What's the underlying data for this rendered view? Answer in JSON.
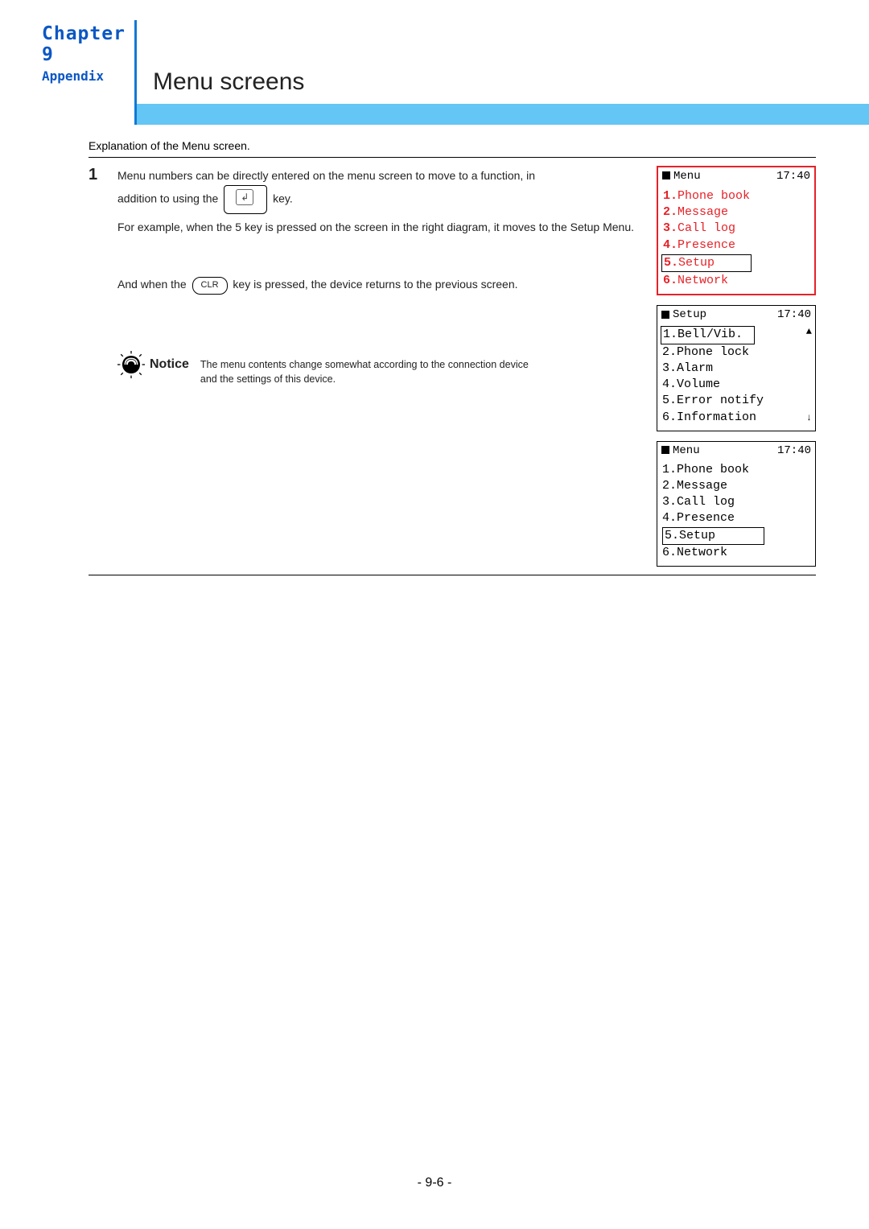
{
  "chapter": {
    "title": "Chapter 9",
    "sub": "Appendix"
  },
  "section": {
    "title": "Menu screens"
  },
  "intro": "Explanation of the Menu screen.",
  "row": {
    "num": "1",
    "p1a": "Menu numbers can be directly entered on the menu screen to move to a function, in",
    "p1b": "addition to using the",
    "p1c": "key.",
    "p2": "For example, when the 5 key is pressed on the screen in the right diagram, it moves to the Setup Menu.",
    "p3a": "And when the",
    "p3b": "key is pressed, the device returns to the previous screen.",
    "clr": "CLR",
    "enter": "↲"
  },
  "notice": {
    "label": "Notice",
    "line1": "The menu contents change somewhat according to the connection device",
    "line2": "and the settings of this device."
  },
  "phone1": {
    "title": "Menu",
    "time": "17:40",
    "items": [
      {
        "n": "1.",
        "t": "Phone book"
      },
      {
        "n": "2.",
        "t": "Message"
      },
      {
        "n": "3.",
        "t": "Call log"
      },
      {
        "n": "4.",
        "t": "Presence"
      },
      {
        "n": "5.",
        "t": "Setup"
      },
      {
        "n": "6.",
        "t": "Network"
      }
    ]
  },
  "phone2": {
    "title": "Setup",
    "time": "17:40",
    "items": [
      "1.Bell/Vib.",
      "2.Phone lock",
      "3.Alarm",
      "4.Volume",
      "5.Error notify",
      "6.Information"
    ]
  },
  "phone3": {
    "title": "Menu",
    "time": "17:40",
    "items": [
      "1.Phone book",
      "2.Message",
      "3.Call log",
      "4.Presence",
      "5.Setup",
      "6.Network"
    ]
  },
  "footer": "- 9-6 -"
}
